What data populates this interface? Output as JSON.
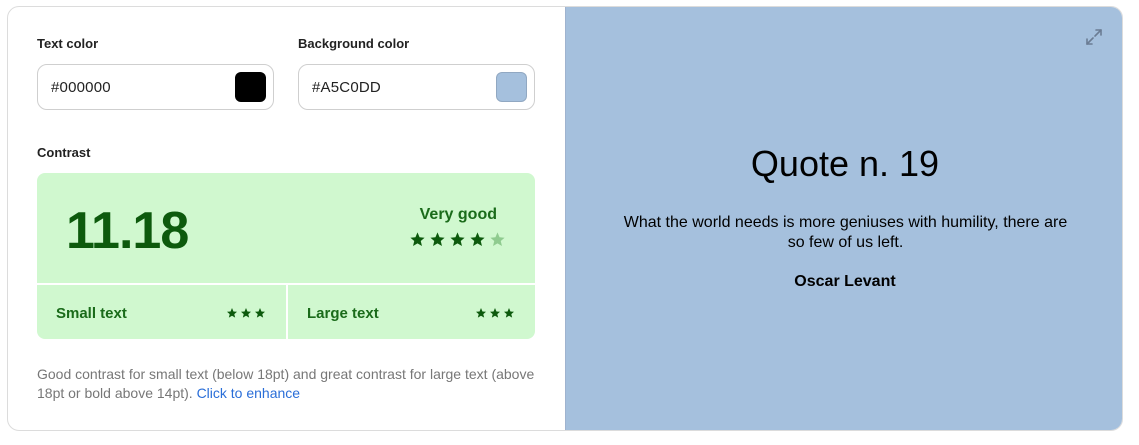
{
  "text_color": {
    "label": "Text color",
    "value": "#000000",
    "swatch": "#000000"
  },
  "background_color": {
    "label": "Background color",
    "value": "#A5C0DD",
    "swatch": "#A5C0DD"
  },
  "contrast": {
    "label": "Contrast",
    "ratio": "11.18",
    "rating_word": "Very good",
    "stars": 4,
    "max_stars": 5,
    "small_text": {
      "label": "Small text",
      "stars": 3
    },
    "large_text": {
      "label": "Large text",
      "stars": 3
    },
    "colors": {
      "bg": "#D0F8CF",
      "star_on": "#0D5A0D",
      "star_off": "#8FCB8F"
    }
  },
  "note": {
    "text": "Good contrast for small text (below 18pt) and great contrast for large text (above 18pt or bold above 14pt).",
    "link": "Click to enhance"
  },
  "preview": {
    "title": "Quote n. 19",
    "text": "What the world needs is more geniuses with humility, there are so few of us left.",
    "author": "Oscar Levant",
    "icon": "expand-icon"
  }
}
